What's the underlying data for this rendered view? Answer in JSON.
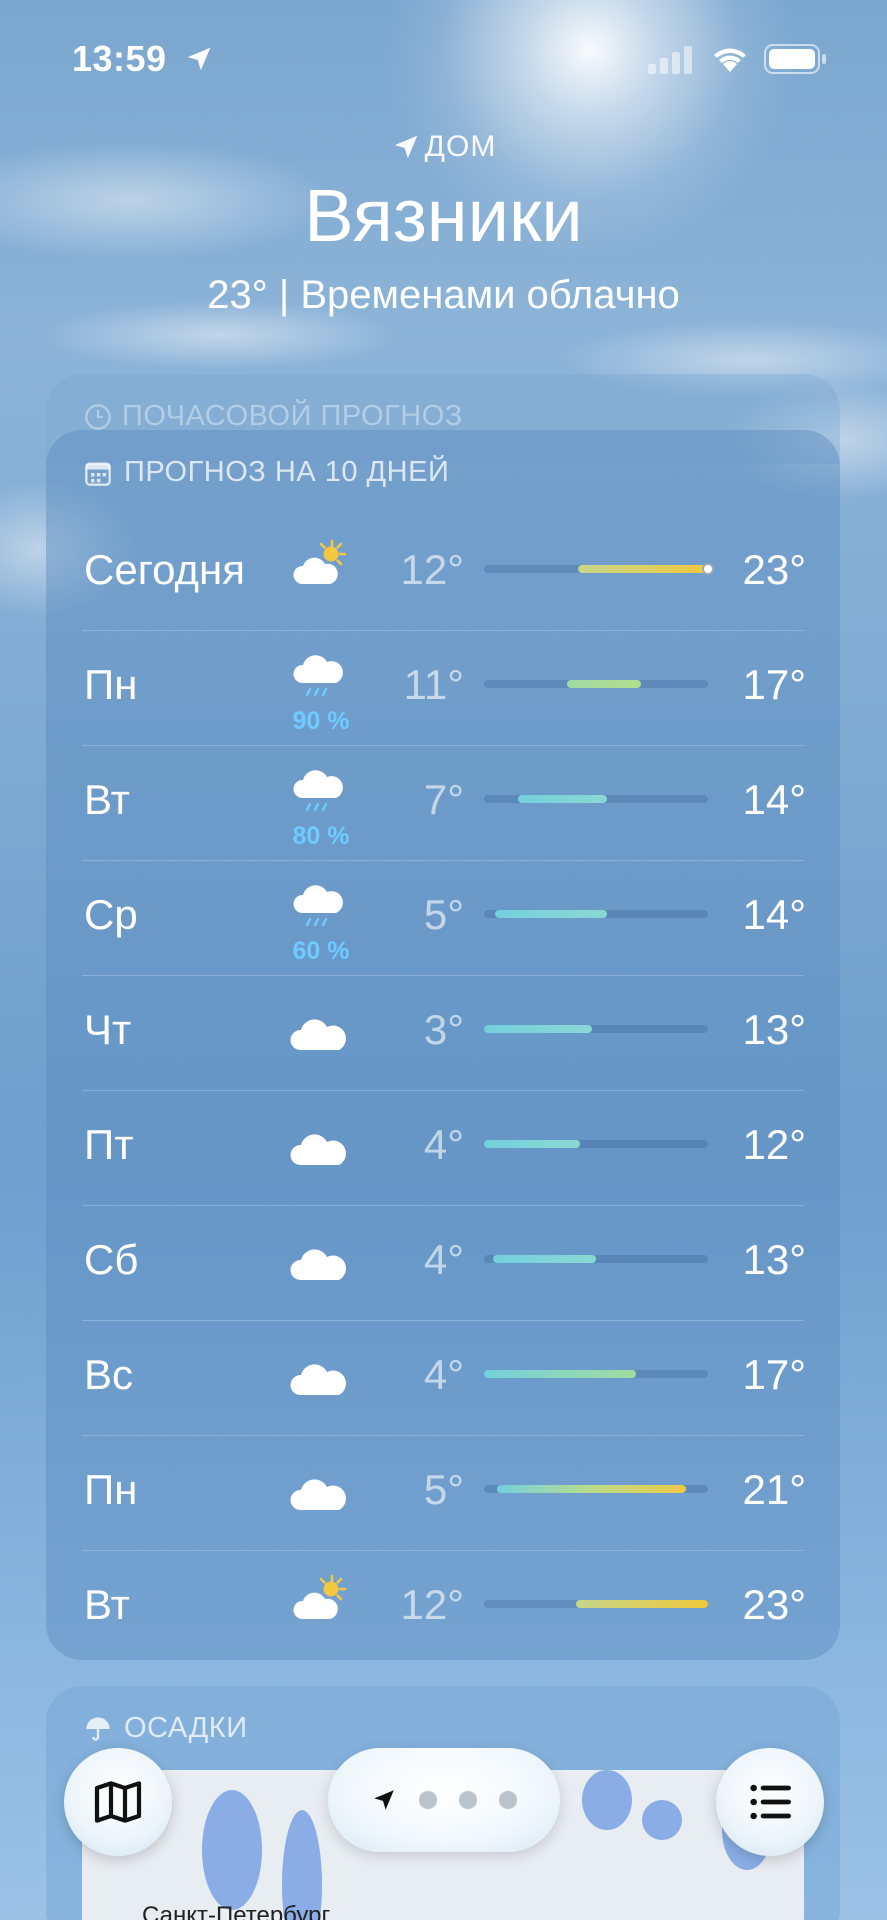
{
  "status": {
    "time": "13:59"
  },
  "header": {
    "location_label": "ДОМ",
    "city": "Вязники",
    "summary": "23°  |  Временами облачно"
  },
  "hourly": {
    "title": "ПОЧАСОВОЙ ПРОГНОЗ"
  },
  "forecast": {
    "title": "ПРОГНОЗ НА 10 ДНЕЙ",
    "days": [
      {
        "day": "Сегодня",
        "icon": "partly-cloudy-sun-icon",
        "precip": "",
        "low": "12°",
        "high": "23°",
        "bar_start": 0.42,
        "bar_end": 1.0,
        "bar_color": "yellow",
        "current_marker": 1.0
      },
      {
        "day": "Пн",
        "icon": "rain-cloud-icon",
        "precip": "90 %",
        "low": "11°",
        "high": "17°",
        "bar_start": 0.37,
        "bar_end": 0.7,
        "bar_color": "green"
      },
      {
        "day": "Вт",
        "icon": "rain-cloud-icon",
        "precip": "80 %",
        "low": "7°",
        "high": "14°",
        "bar_start": 0.15,
        "bar_end": 0.55,
        "bar_color": "teal"
      },
      {
        "day": "Ср",
        "icon": "rain-cloud-icon",
        "precip": "60 %",
        "low": "5°",
        "high": "14°",
        "bar_start": 0.05,
        "bar_end": 0.55,
        "bar_color": "teal"
      },
      {
        "day": "Чт",
        "icon": "cloud-icon",
        "precip": "",
        "low": "3°",
        "high": "13°",
        "bar_start": 0.0,
        "bar_end": 0.48,
        "bar_color": "teal"
      },
      {
        "day": "Пт",
        "icon": "cloud-icon",
        "precip": "",
        "low": "4°",
        "high": "12°",
        "bar_start": 0.0,
        "bar_end": 0.43,
        "bar_color": "teal"
      },
      {
        "day": "Сб",
        "icon": "cloud-icon",
        "precip": "",
        "low": "4°",
        "high": "13°",
        "bar_start": 0.04,
        "bar_end": 0.5,
        "bar_color": "teal"
      },
      {
        "day": "Вс",
        "icon": "cloud-icon",
        "precip": "",
        "low": "4°",
        "high": "17°",
        "bar_start": 0.0,
        "bar_end": 0.68,
        "bar_color": "teal-green"
      },
      {
        "day": "Пн",
        "icon": "cloud-icon",
        "precip": "",
        "low": "5°",
        "high": "21°",
        "bar_start": 0.06,
        "bar_end": 0.9,
        "bar_color": "teal-yellow"
      },
      {
        "day": "Вт",
        "icon": "partly-cloudy-sun-icon",
        "precip": "",
        "low": "12°",
        "high": "23°",
        "bar_start": 0.41,
        "bar_end": 1.0,
        "bar_color": "yellow"
      }
    ]
  },
  "precipitation": {
    "title": "ОСАДКИ",
    "map_city": "Санкт-Петербург"
  },
  "bottom_bar": {
    "map_button": "map-icon",
    "page_dots": 3,
    "list_button": "list-icon"
  },
  "colors": {
    "yellow": "#f1c93c",
    "green": "#a6dc9a",
    "teal": "#7fd3dc",
    "precip_blue": "#6ccbff"
  }
}
